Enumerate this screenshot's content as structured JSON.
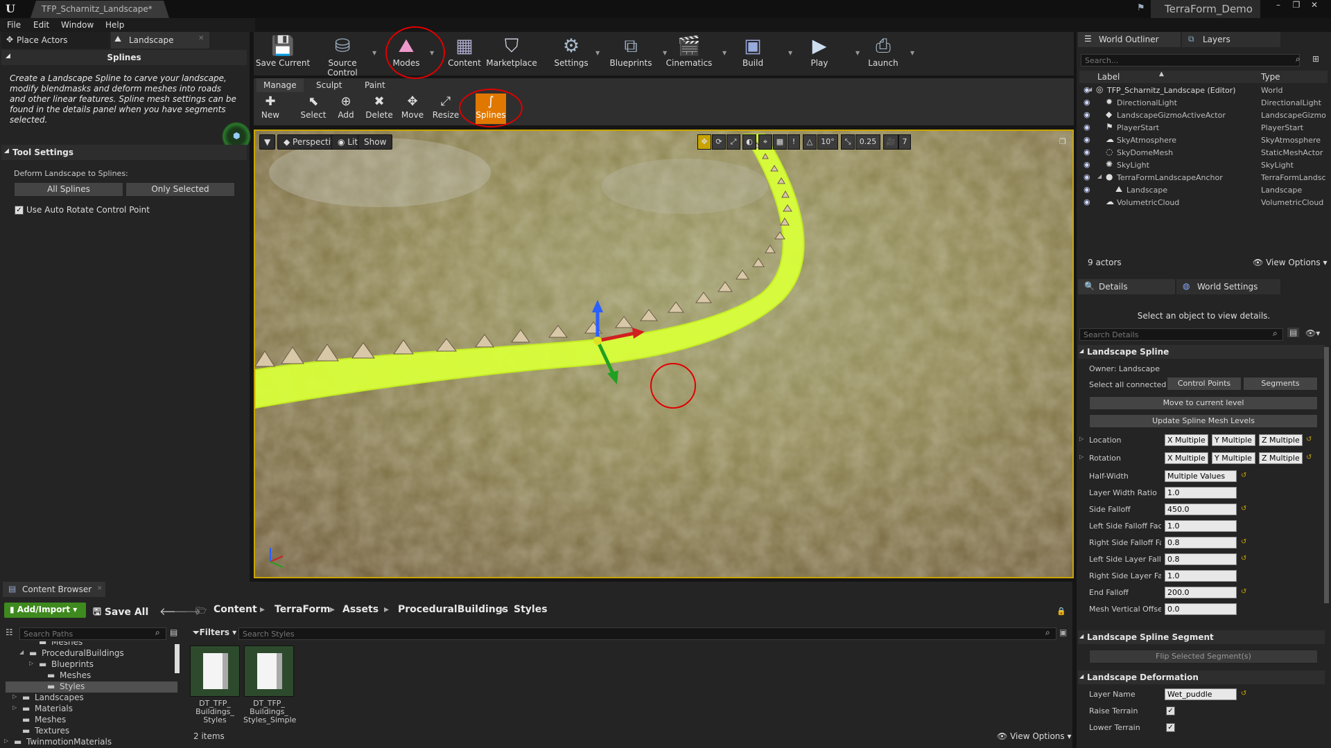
{
  "window": {
    "doc_tab": "TFP_Scharnitz_Landscape*",
    "project": "TerraForm_Demo"
  },
  "menu": [
    "File",
    "Edit",
    "Window",
    "Help"
  ],
  "left_panel": {
    "tabs": [
      "Place Actors",
      "Landscape"
    ],
    "mode_title": "Splines",
    "description": "Create a Landscape Spline to carve your landscape, modify blendmasks and deform meshes into roads and other linear features. Spline mesh settings can be found in the details panel when you have segments selected.",
    "tool_settings": "Tool Settings",
    "deform_label": "Deform Landscape to Splines:",
    "all_splines": "All Splines",
    "only_selected": "Only Selected",
    "auto_rotate": "Use Auto Rotate Control Point"
  },
  "toolbar": [
    "Save Current",
    "Source Control",
    "Modes",
    "Content",
    "Marketplace",
    "Settings",
    "Blueprints",
    "Cinematics",
    "Build",
    "Play",
    "Launch"
  ],
  "mode_tabs": [
    "Manage",
    "Sculpt",
    "Paint"
  ],
  "manage_tools": [
    "New",
    "Select",
    "Add",
    "Delete",
    "Move",
    "Resize",
    "Splines"
  ],
  "viewport": {
    "perspective": "Perspective",
    "lit": "Lit",
    "show": "Show",
    "rot_snap": "10°",
    "scale_snap": "0.25",
    "cam_speed": "7"
  },
  "outliner": {
    "tabs": [
      "World Outliner",
      "Layers"
    ],
    "search": "Search...",
    "col_label": "Label",
    "col_type": "Type",
    "rows": [
      {
        "label": "TFP_Scharnitz_Landscape (Editor)",
        "type": "World"
      },
      {
        "label": "DirectionalLight",
        "type": "DirectionalLight"
      },
      {
        "label": "LandscapeGizmoActiveActor",
        "type": "LandscapeGizmo"
      },
      {
        "label": "PlayerStart",
        "type": "PlayerStart"
      },
      {
        "label": "SkyAtmosphere",
        "type": "SkyAtmosphere"
      },
      {
        "label": "SkyDomeMesh",
        "type": "StaticMeshActor"
      },
      {
        "label": "SkyLight",
        "type": "SkyLight"
      },
      {
        "label": "TerraFormLandscapeAnchor",
        "type": "TerraFormLandsc"
      },
      {
        "label": "Landscape",
        "type": "Landscape"
      },
      {
        "label": "VolumetricCloud",
        "type": "VolumetricCloud"
      }
    ],
    "count": "9 actors",
    "view_options": "View Options"
  },
  "details": {
    "tabs": [
      "Details",
      "World Settings"
    ],
    "hint": "Select an object to view details.",
    "search": "Search Details",
    "spline_header": "Landscape Spline",
    "owner": "Owner: Landscape",
    "select_all": "Select all connected:",
    "control_points": "Control Points",
    "segments": "Segments",
    "move_level": "Move to current level",
    "update_mesh": "Update Spline Mesh Levels",
    "location": "Location",
    "rotation": "Rotation",
    "x": "X",
    "y": "Y",
    "z": "Z",
    "multiple": "Multiple",
    "props": [
      {
        "label": "Half-Width",
        "value": "Multiple Values"
      },
      {
        "label": "Layer Width Ratio",
        "value": "1.0"
      },
      {
        "label": "Side Falloff",
        "value": "450.0"
      },
      {
        "label": "Left Side Falloff Fact",
        "value": "1.0"
      },
      {
        "label": "Right Side Falloff Fac",
        "value": "0.8"
      },
      {
        "label": "Left Side Layer Fallo",
        "value": "0.8"
      },
      {
        "label": "Right Side Layer Falk",
        "value": "1.0"
      },
      {
        "label": "End Falloff",
        "value": "200.0"
      },
      {
        "label": "Mesh Vertical Offset",
        "value": "0.0"
      }
    ],
    "segment_header": "Landscape Spline Segment",
    "flip": "Flip Selected Segment(s)",
    "deform_header": "Landscape Deformation",
    "layer_name_label": "Layer Name",
    "layer_name": "Wet_puddle",
    "raise": "Raise Terrain",
    "lower": "Lower Terrain"
  },
  "content_browser": {
    "tab": "Content Browser",
    "add_import": "Add/Import",
    "save_all": "Save All",
    "breadcrumbs": [
      "Content",
      "TerraForm",
      "Assets",
      "ProceduralBuildings",
      "Styles"
    ],
    "search_paths": "Search Paths",
    "filters": "Filters",
    "search_styles": "Search Styles",
    "tree": [
      "Meshes",
      "ProceduralBuildings",
      "Blueprints",
      "Meshes",
      "Styles",
      "Landscapes",
      "Materials",
      "Meshes",
      "Textures",
      "TwinmotionMaterials"
    ],
    "assets": [
      [
        "DT_TFP_",
        "Buildings_",
        "Styles"
      ],
      [
        "DT_TFP_",
        "Buildings_",
        "Styles_Simple"
      ]
    ],
    "count": "2 items",
    "view_options": "View Options"
  }
}
